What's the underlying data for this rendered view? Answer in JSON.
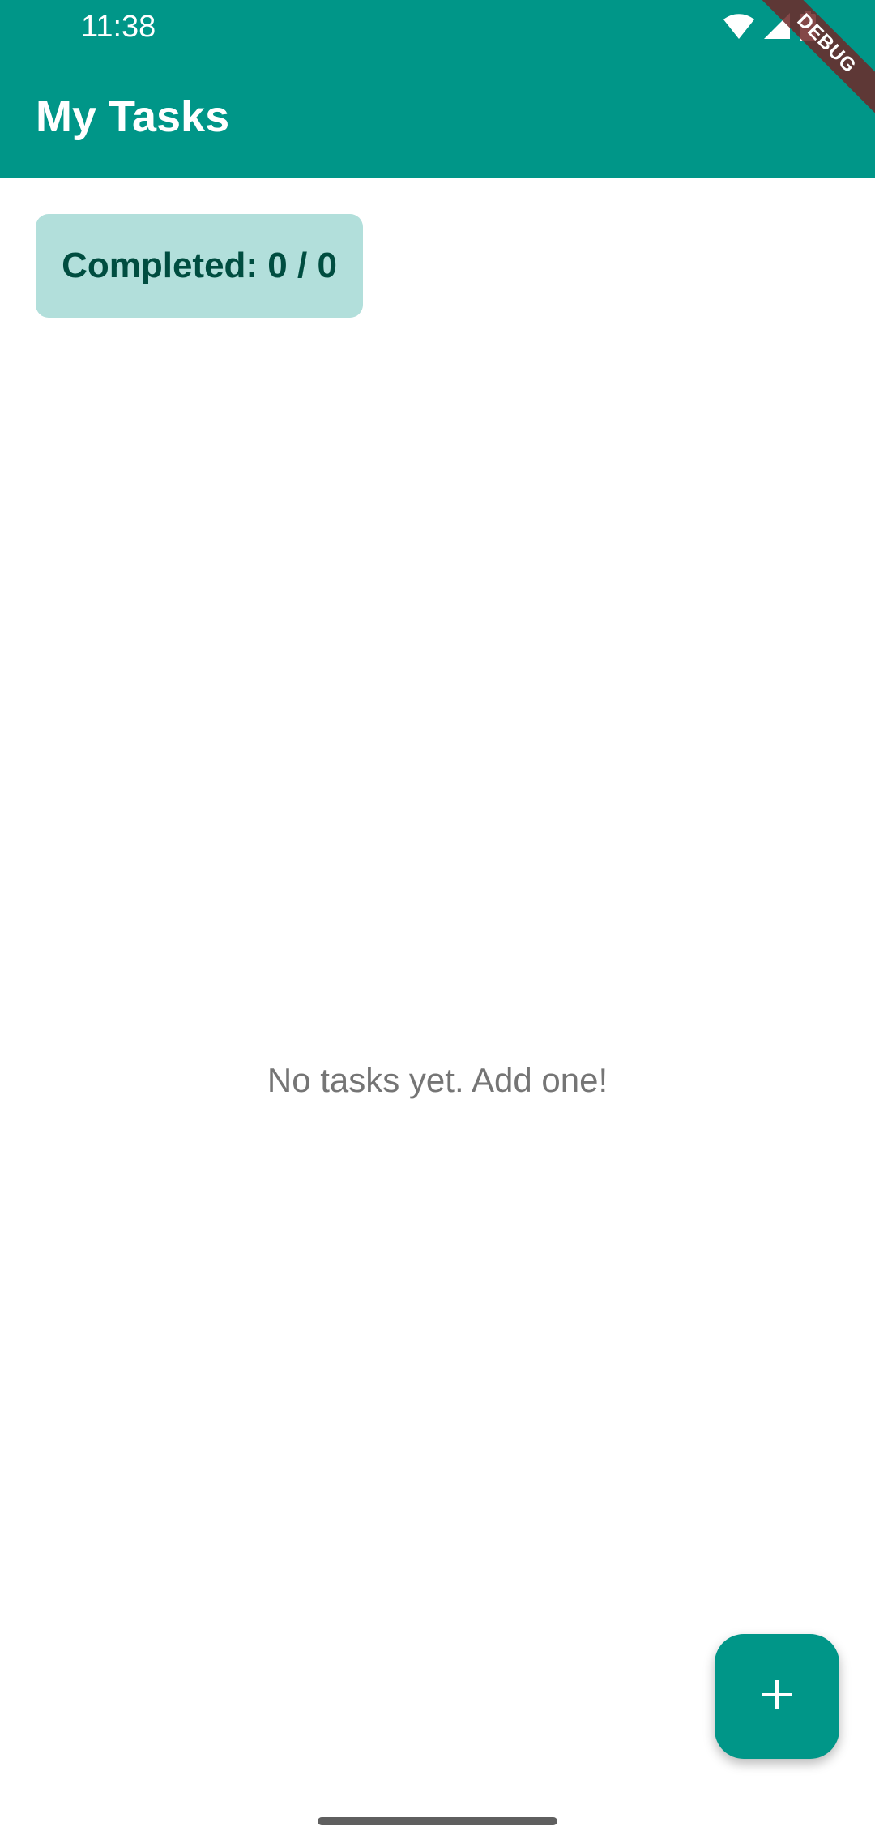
{
  "status_bar": {
    "time": "11:38"
  },
  "app_bar": {
    "title": "My Tasks",
    "debug_label": "DEBUG"
  },
  "summary": {
    "completed_text": "Completed: 0 / 0"
  },
  "empty_state": {
    "message": "No tasks yet. Add one!"
  },
  "fab": {
    "icon": "plus-icon"
  },
  "colors": {
    "primary": "#009688",
    "chip_background": "#b2dfdb",
    "chip_text": "#004d40",
    "empty_text": "#757575"
  }
}
